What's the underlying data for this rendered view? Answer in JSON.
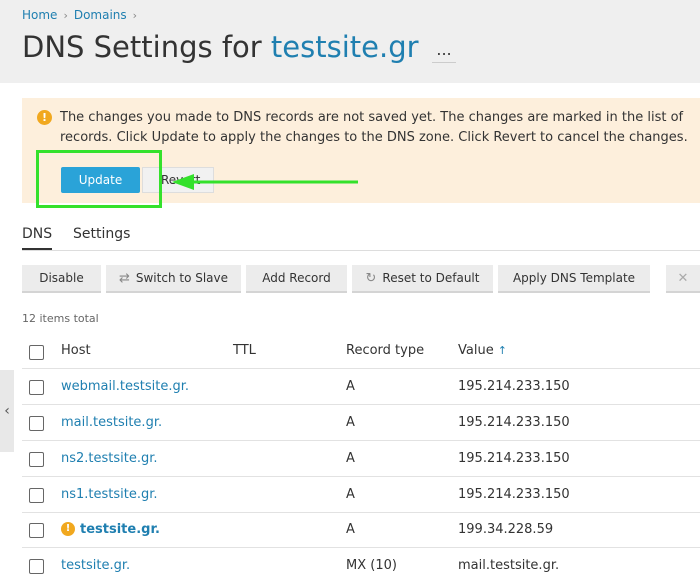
{
  "breadcrumb": [
    "Home",
    "Domains"
  ],
  "title": {
    "prefix": "DNS Settings for",
    "domain": "testsite.gr",
    "more": "..."
  },
  "alert": {
    "text": "The changes you made to DNS records are not saved yet. The changes are marked in the list of records. Click Update to apply the changes to the DNS zone. Click Revert to cancel the changes.",
    "update_label": "Update",
    "revert_label": "Revert"
  },
  "tabs": [
    "DNS",
    "Settings"
  ],
  "toolbar": {
    "disable": "Disable",
    "switch_to_slave": "Switch to Slave",
    "add_record": "Add Record",
    "reset_to_default": "Reset to Default",
    "apply_dns_template": "Apply DNS Template"
  },
  "items_total": "12 items total",
  "columns": {
    "host": "Host",
    "ttl": "TTL",
    "record_type": "Record type",
    "value": "Value"
  },
  "rows": [
    {
      "host": "webmail.testsite.gr.",
      "ttl": "",
      "type": "A",
      "value": "195.214.233.150"
    },
    {
      "host": "mail.testsite.gr.",
      "ttl": "",
      "type": "A",
      "value": "195.214.233.150"
    },
    {
      "host": "ns2.testsite.gr.",
      "ttl": "",
      "type": "A",
      "value": "195.214.233.150"
    },
    {
      "host": "ns1.testsite.gr.",
      "ttl": "",
      "type": "A",
      "value": "195.214.233.150"
    },
    {
      "host": "testsite.gr.",
      "ttl": "",
      "type": "A",
      "value": "199.34.228.59"
    },
    {
      "host": "testsite.gr.",
      "ttl": "",
      "type": "MX (10)",
      "value": "mail.testsite.gr."
    }
  ],
  "colors": {
    "accent": "#1f7fb0",
    "update_button": "#2aa3d8",
    "alert_bg": "#fdefdc",
    "warning": "#f1a81f",
    "annotation": "#34e12b"
  }
}
